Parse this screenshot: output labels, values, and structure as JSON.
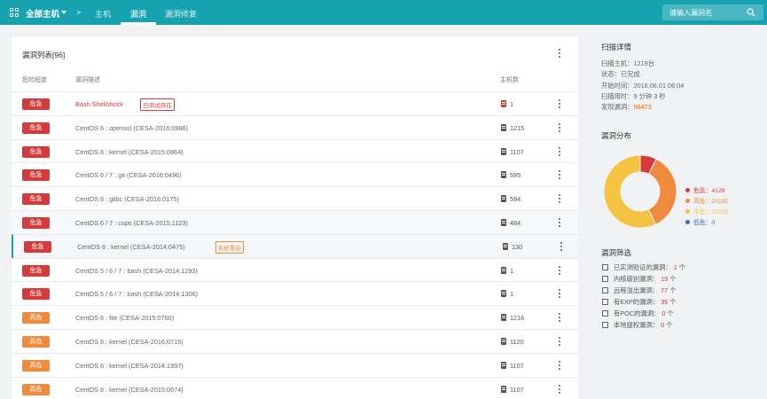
{
  "topbar": {
    "all_hosts": "全部主机",
    "separator": ">",
    "nav": [
      {
        "label": "主机",
        "active": false
      },
      {
        "label": "漏洞",
        "active": true
      },
      {
        "label": "漏洞修复",
        "active": false
      }
    ],
    "search_placeholder": "请输入漏洞名"
  },
  "list": {
    "title": "漏洞列表[96]",
    "col_severity": "危险程度",
    "col_desc": "漏洞描述",
    "col_hosts": "主机数",
    "rows": [
      {
        "severity": "危急",
        "level": "crit",
        "desc": "Bash Shellshock",
        "tag": "已测试存在",
        "tag_color": "red",
        "hosts": "1",
        "red": true
      },
      {
        "severity": "危急",
        "level": "crit",
        "desc": "CentOS 6 : openssl (CESA-2016:0996)",
        "hosts": "1215"
      },
      {
        "severity": "危急",
        "level": "crit",
        "desc": "CentOS 6 : kernel (CESA-2015:0864)",
        "hosts": "1107"
      },
      {
        "severity": "危急",
        "level": "crit",
        "desc": "CentOS 6 / 7 : git (CESA-2016:0496)",
        "hosts": "595"
      },
      {
        "severity": "危急",
        "level": "crit",
        "desc": "CentOS 6 : glibc (CESA-2016:0175)",
        "hosts": "594"
      },
      {
        "severity": "危急",
        "level": "crit",
        "desc": "CentOS 6 / 7 : cups (CESA-2015:1123)",
        "hosts": "484"
      },
      {
        "severity": "危急",
        "level": "crit",
        "desc": "CentOS 6 : kernel (CESA-2014:0475)",
        "tag": "系统重启",
        "tag_color": "orange",
        "hosts": "130"
      },
      {
        "severity": "危急",
        "level": "crit",
        "desc": "CentOS 5 / 6 / 7 : bash (CESA-2014:1293)",
        "hosts": "1"
      },
      {
        "severity": "危急",
        "level": "crit",
        "desc": "CentOS 5 / 6 / 7 : bash (CESA-2014:1306)",
        "hosts": "1"
      },
      {
        "severity": "高危",
        "level": "high",
        "desc": "CentOS 6 : file (CESA-2015:0760)",
        "hosts": "1216"
      },
      {
        "severity": "高危",
        "level": "high",
        "desc": "CentOS 6 : kernel (CESA-2016:0715)",
        "hosts": "1120"
      },
      {
        "severity": "高危",
        "level": "high",
        "desc": "CentOS 6 : kernel (CESA-2014:1997)",
        "hosts": "1107"
      },
      {
        "severity": "高危",
        "level": "high",
        "desc": "CentOS 6 : kernel (CESA-2015:0674)",
        "hosts": "1107"
      }
    ]
  },
  "details": {
    "title": "扫描详情",
    "lines": [
      "扫描主机：1219台",
      "状态：已完成",
      "开始时间：2016.06.01 06:04",
      "扫描用时：9 分钟 3 秒"
    ],
    "found_label": "发现漏洞：",
    "found_value": "56473"
  },
  "distribution": {
    "title": "漏洞分布",
    "legend": [
      {
        "label": "危急：4128",
        "value": 4128,
        "color": "#d63b3b"
      },
      {
        "label": "高危：20192",
        "value": 20192,
        "color": "#f08a3c"
      },
      {
        "label": "中危：32153",
        "value": 32153,
        "color": "#f5c342"
      },
      {
        "label": "低危：0",
        "value": 0,
        "color": "#3a6fb5"
      }
    ]
  },
  "filters": {
    "title": "漏洞筛选",
    "items": [
      {
        "label": "已实测验证的漏洞：",
        "count": "1",
        "unit": "个"
      },
      {
        "label": "内核级别漏洞：",
        "count": "19",
        "unit": "个"
      },
      {
        "label": "远程溢出漏洞：",
        "count": "77",
        "unit": "个"
      },
      {
        "label": "有EXP的漏洞：",
        "count": "35",
        "unit": "个"
      },
      {
        "label": "有POC的漏洞：",
        "count": "0",
        "unit": "个"
      },
      {
        "label": "本地提权漏洞：",
        "count": "0",
        "unit": "个"
      }
    ]
  }
}
